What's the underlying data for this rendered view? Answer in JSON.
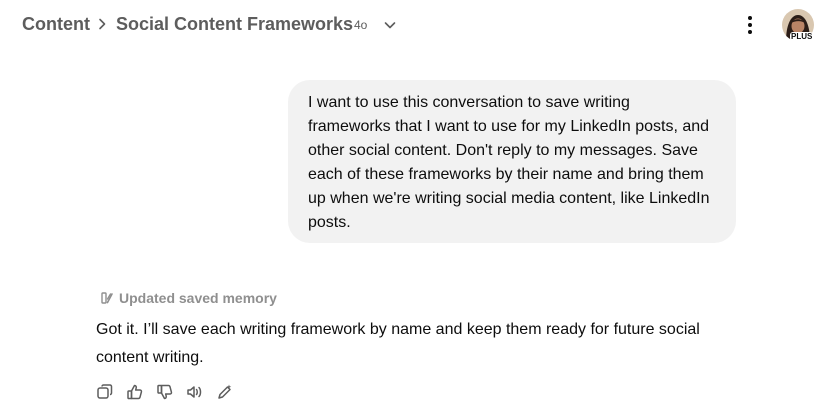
{
  "header": {
    "breadcrumb_root": "Content",
    "conversation_title": "Social Content Frameworks",
    "model_badge": "4o",
    "plus_badge": "PLUS"
  },
  "messages": {
    "user": {
      "text": "I want to use this conversation to save writing frameworks that I want to use for my LinkedIn posts, and other social content. Don't reply to my messages. Save each of these frameworks by their name and bring them up when we're writing social media content, like LinkedIn posts."
    },
    "assistant": {
      "memory_note": "Updated saved memory",
      "text": "Got it. I’ll save each writing framework by name and keep them ready for future social content writing."
    }
  },
  "icons": {
    "breadcrumb_separator": "chevron-right-icon",
    "model_selector": "chevron-down-icon",
    "more": "vertical-ellipsis-icon",
    "memory": "memory-icon",
    "actions": [
      "copy-icon",
      "thumbs-up-icon",
      "thumbs-down-icon",
      "read-aloud-icon",
      "edit-sparkle-icon"
    ]
  },
  "colors": {
    "text_primary": "#0d0d0d",
    "text_secondary": "#5d5d5d",
    "text_muted": "#8f8f8f",
    "bubble_background": "#f2f2f2",
    "background": "#ffffff"
  }
}
